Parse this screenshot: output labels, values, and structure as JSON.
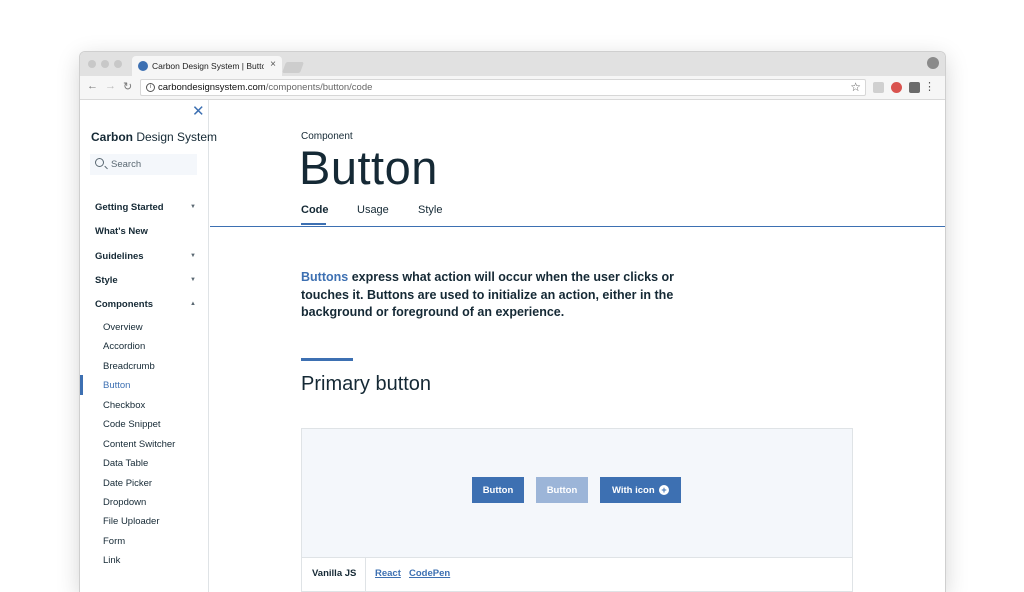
{
  "browser": {
    "tab_title": "Carbon Design System | Button",
    "tab_close": "×",
    "url_host": "carbondesignsystem.com",
    "url_path": "/components/button/code"
  },
  "sidebar": {
    "brand_bold": "Carbon",
    "brand_rest": " Design System",
    "search_placeholder": "Search",
    "sections": [
      {
        "label": "Getting Started",
        "expandable": true
      },
      {
        "label": "What's New",
        "expandable": false
      },
      {
        "label": "Guidelines",
        "expandable": true
      },
      {
        "label": "Style",
        "expandable": true
      },
      {
        "label": "Components",
        "expandable": true,
        "expanded": true
      }
    ],
    "components": [
      "Overview",
      "Accordion",
      "Breadcrumb",
      "Button",
      "Checkbox",
      "Code Snippet",
      "Content Switcher",
      "Data Table",
      "Date Picker",
      "Dropdown",
      "File Uploader",
      "Form",
      "Link"
    ],
    "active_component": "Button"
  },
  "page": {
    "eyebrow": "Component",
    "title": "Button",
    "tabs": [
      "Code",
      "Usage",
      "Style"
    ],
    "selected_tab": "Code",
    "lead_link": "Buttons",
    "lead_text": " express what action will occur when the user clicks or touches it. Buttons are used to initialize an action, either in the background or foreground of an experience.",
    "section_title": "Primary button",
    "demo_buttons": {
      "primary": "Button",
      "disabled": "Button",
      "with_icon": "With icon"
    },
    "code_tabs": [
      "Vanilla JS",
      "React",
      "CodePen"
    ]
  },
  "colors": {
    "accent": "#3d70b2",
    "disabled": "#9cb5d8",
    "text": "#152935"
  }
}
